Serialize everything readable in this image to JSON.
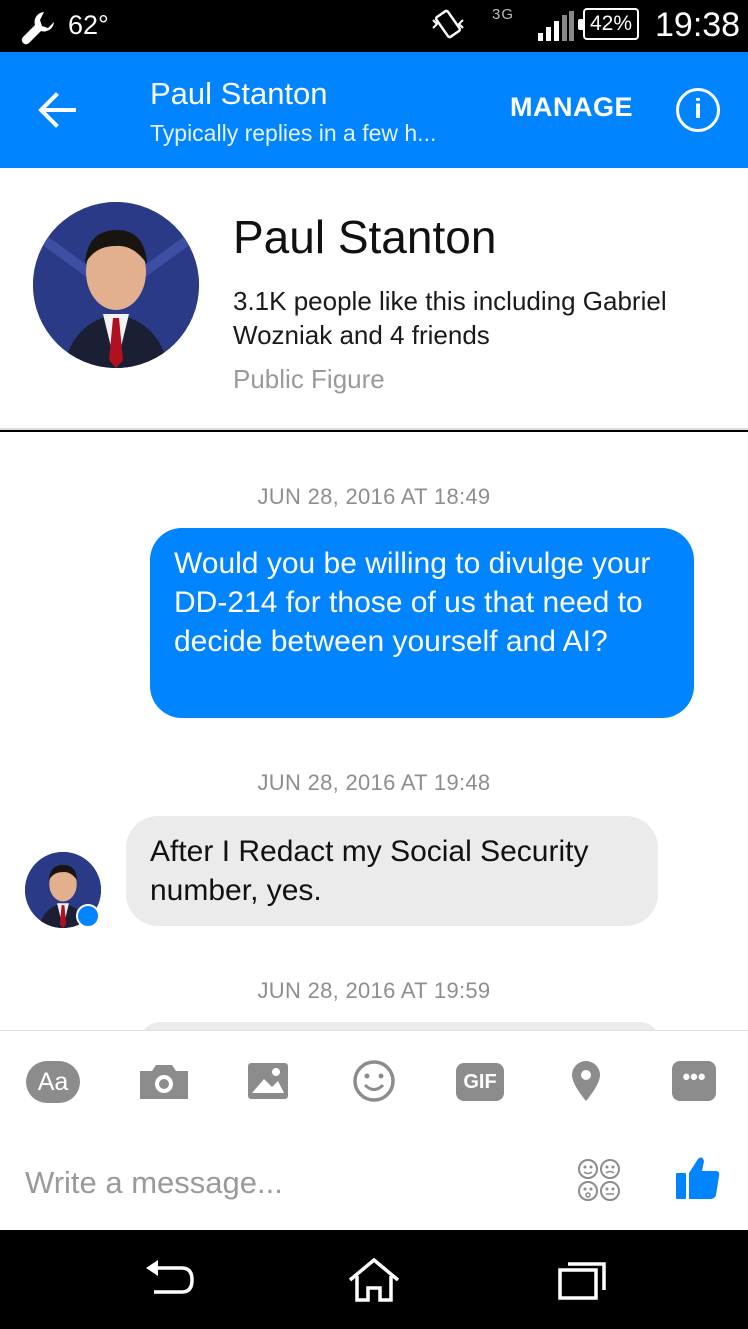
{
  "status_bar": {
    "temperature": "62°",
    "network": "3G",
    "battery": "42%",
    "time": "19:38"
  },
  "header": {
    "title": "Paul Stanton",
    "subtitle": "Typically replies in a few h...",
    "manage_label": "MANAGE",
    "info_glyph": "i",
    "color": "#0084ff"
  },
  "profile": {
    "name": "Paul Stanton",
    "likes": "3.1K people like this including Gabriel Wozniak and 4 friends",
    "category": "Public Figure"
  },
  "messages": [
    {
      "timestamp": "JUN 28, 2016 AT 18:49",
      "direction": "outgoing",
      "text": "Would you be willing to divulge your DD-214 for those of us that need to decide between yourself and AI?"
    },
    {
      "timestamp": "JUN 28, 2016 AT 19:48",
      "direction": "incoming",
      "text": "After I Redact my Social Security number, yes."
    },
    {
      "timestamp": "JUN 28, 2016 AT 19:59",
      "direction": "incoming",
      "text": ""
    }
  ],
  "composer": {
    "tools": [
      "text-format-icon",
      "camera-icon",
      "image-icon",
      "emoji-icon",
      "gif-icon",
      "location-icon",
      "more-icon"
    ],
    "aa_label": "Aa",
    "gif_label": "GIF",
    "more_label": "•••",
    "placeholder": "Write a message..."
  },
  "nav": [
    "back-icon",
    "home-icon",
    "recent-apps-icon"
  ],
  "colors": {
    "accent": "#0084ff",
    "incoming_bubble": "#ebebeb",
    "timestamp": "#8e8e8e"
  }
}
